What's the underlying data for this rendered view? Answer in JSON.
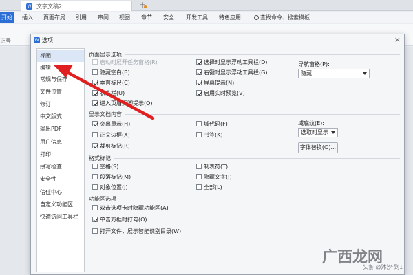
{
  "app": {
    "doc_tab_icon": "W",
    "doc_tab_title": "文字文稿2",
    "new_tab": "+",
    "modified_dot_color": "#e08a1e"
  },
  "menubar": {
    "start": "开始",
    "items": [
      "插入",
      "页面布局",
      "引用",
      "审阅",
      "视图",
      "章节",
      "安全",
      "开发工具",
      "特色应用"
    ],
    "search": "查找命令、搜索模板"
  },
  "toolbar": {
    "left_label": "正号"
  },
  "dialog": {
    "icon": "W",
    "title": "选项",
    "close": "×",
    "nav": [
      "视图",
      "编辑",
      "常规与保存",
      "文件位置",
      "修订",
      "中文版式",
      "输出PDF",
      "用户信息",
      "打印",
      "拼写检查",
      "安全性",
      "信任中心",
      "自定义功能区",
      "快速访问工具栏"
    ],
    "nav_active_index": 0,
    "page_display": {
      "title": "页面显示选项",
      "left": [
        {
          "label": "启动时展开任务窗格(R)",
          "checked": false,
          "disabled": true
        },
        {
          "label": "隐藏空白(B)",
          "checked": false,
          "disabled": false
        },
        {
          "label": "垂直标尺(C)",
          "checked": true,
          "disabled": false
        },
        {
          "label": "状态栏(U)",
          "checked": true,
          "disabled": false
        },
        {
          "label": "进入页眉页脚提示(Q)",
          "checked": true,
          "disabled": false
        }
      ],
      "right": [
        {
          "label": "选择时显示浮动工具栏(D)",
          "checked": true,
          "disabled": false
        },
        {
          "label": "右键时显示浮动工具栏(G)",
          "checked": true,
          "disabled": false
        },
        {
          "label": "屏幕提示(N)",
          "checked": true,
          "disabled": false
        },
        {
          "label": "启用实时预览(V)",
          "checked": true,
          "disabled": false
        }
      ],
      "nav_pane_label": "导航窗格(P):",
      "nav_pane_value": "隐藏"
    },
    "doc_content": {
      "title": "显示文档内容",
      "left": [
        {
          "label": "突出显示(H)",
          "checked": true
        },
        {
          "label": "正文边框(X)",
          "checked": false
        },
        {
          "label": "裁剪标记(R)",
          "checked": true
        }
      ],
      "right": [
        {
          "label": "域代码(F)",
          "checked": false
        },
        {
          "label": "书签(K)",
          "checked": false
        }
      ],
      "field_shading_label": "域底纹(E):",
      "field_shading_value": "选取时显示",
      "font_replace_button": "字体替换(O)..."
    },
    "format_marks": {
      "title": "格式标记",
      "left": [
        {
          "label": "空格(S)",
          "checked": false
        },
        {
          "label": "段落标记(M)",
          "checked": false
        },
        {
          "label": "对象位置(J)",
          "checked": false
        }
      ],
      "right": [
        {
          "label": "制表符(T)",
          "checked": false
        },
        {
          "label": "隐藏文字(I)",
          "checked": false
        },
        {
          "label": "全部(L)",
          "checked": false
        }
      ]
    },
    "ribbon": {
      "title": "功能区选项",
      "items": [
        {
          "label": "双击选项卡时隐藏功能区(A)",
          "checked": false
        },
        {
          "label": "单击方框时打勾(O)",
          "checked": true
        },
        {
          "label": "打开文件，展示智能识别目录(W)",
          "checked": false
        }
      ]
    }
  },
  "annotation": {
    "arrow_color": "#e02020"
  },
  "watermark": {
    "big": "广西龙网",
    "small": "头条 @沐汐·到1"
  }
}
